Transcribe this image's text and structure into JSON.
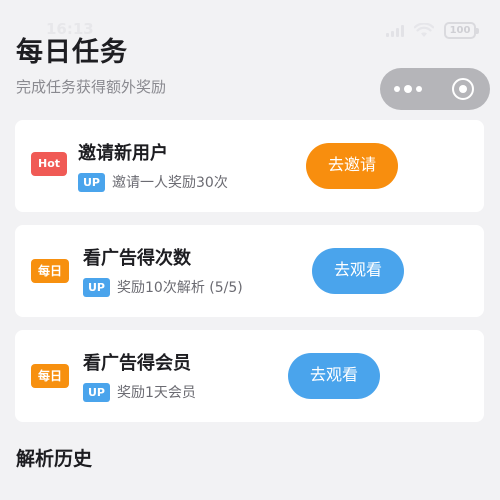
{
  "status_bar": {
    "time": "16:13",
    "battery": "100",
    "icons": [
      "signal-icon",
      "wifi-icon",
      "battery-icon"
    ]
  },
  "header": {
    "title": "每日任务",
    "subtitle": "完成任务获得额外奖励"
  },
  "capsule": {
    "icons": [
      "more-icon",
      "close-icon"
    ]
  },
  "tasks": [
    {
      "tag": "Hot",
      "title": "邀请新用户",
      "badge": "UP",
      "description": "邀请一人奖励30次",
      "button": "去邀请"
    },
    {
      "tag": "每日",
      "title": "看广告得次数",
      "badge": "UP",
      "description": "奖励10次解析 (5/5)",
      "button": "去观看"
    },
    {
      "tag": "每日",
      "title": "看广告得会员",
      "badge": "UP",
      "description": "奖励1天会员",
      "button": "去观看"
    }
  ],
  "history": {
    "title": "解析历史"
  },
  "colors": {
    "background": "#f2f2f4",
    "hot": "#f05a55",
    "daily": "#f7900f",
    "invite_button": "#f88e0e",
    "watch_button": "#4aa4ec"
  }
}
